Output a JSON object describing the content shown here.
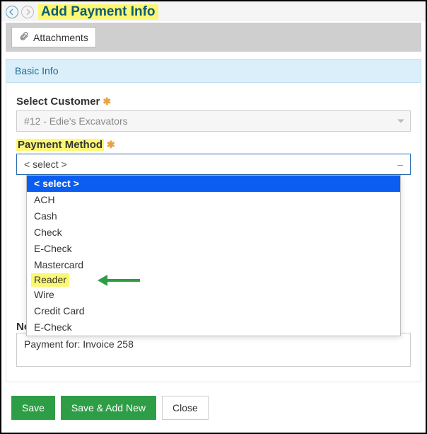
{
  "header": {
    "title": "Add Payment Info",
    "attachments_label": "Attachments"
  },
  "section": {
    "basic_info": "Basic Info"
  },
  "customer": {
    "label": "Select Customer",
    "value": "#12 - Edie's Excavators"
  },
  "payment_method": {
    "label": "Payment Method",
    "placeholder": "< select >",
    "options": [
      "< select >",
      "ACH",
      "Cash",
      "Check",
      "E-Check",
      "Mastercard",
      "Reader",
      "Wire",
      "Credit Card",
      "E-Check"
    ],
    "highlighted_option_index": 6
  },
  "notes": {
    "label": "Notes",
    "value": "Payment for: Invoice 258"
  },
  "footer": {
    "save": "Save",
    "save_add_new": "Save & Add New",
    "close": "Close"
  }
}
